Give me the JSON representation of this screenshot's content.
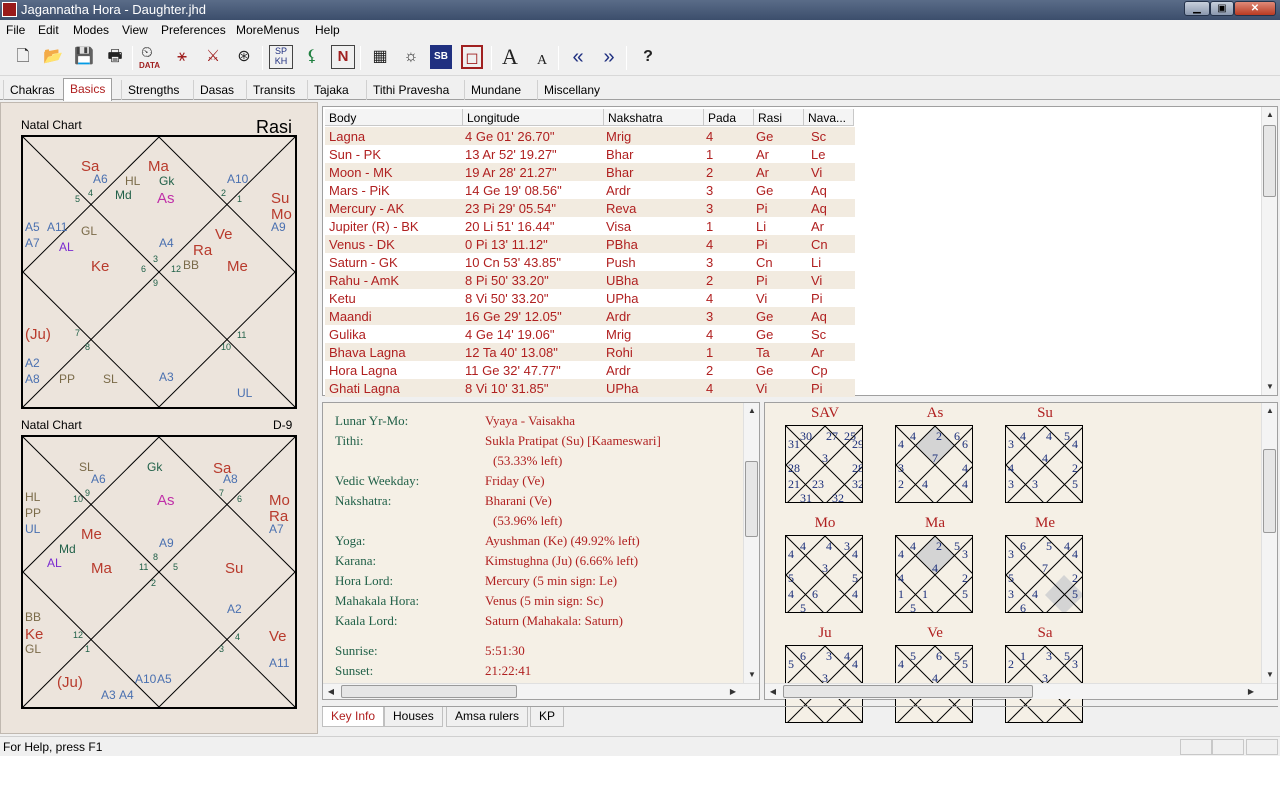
{
  "window": {
    "title": "Jagannatha Hora - Daughter.jhd"
  },
  "menu": [
    "File",
    "Edit",
    "Modes",
    "View",
    "Preferences",
    "MoreMenus",
    "Help"
  ],
  "toolbar": {
    "data_label": "DATA",
    "spkh_top": "SP",
    "spkh_bottom": "KH",
    "n_label": "N",
    "sb_label": "SB",
    "font_large": "A",
    "font_small": "A",
    "help_label": "?"
  },
  "tabs": [
    "Chakras",
    "Basics",
    "Strengths",
    "Dasas",
    "Transits",
    "Tajaka",
    "Tithi Pravesha",
    "Mundane",
    "Miscellany"
  ],
  "active_tab": "Basics",
  "chart1": {
    "label": "Natal Chart",
    "type": "Rasi",
    "items": [
      {
        "t": "Sa",
        "c": "#b83a2c"
      },
      {
        "t": "Ma",
        "c": "#b83a2c"
      },
      {
        "t": "A6",
        "c": "#4a70b0"
      },
      {
        "t": "HL",
        "c": "#7a6a48"
      },
      {
        "t": "Gk",
        "c": "#206048"
      },
      {
        "t": "Md",
        "c": "#206048"
      },
      {
        "t": "As",
        "c": "#c030a8"
      },
      {
        "t": "5",
        "c": "#206048"
      },
      {
        "t": "4",
        "c": "#206048"
      },
      {
        "t": "A10",
        "c": "#4a70b0"
      },
      {
        "t": "2",
        "c": "#206048"
      },
      {
        "t": "1",
        "c": "#206048"
      },
      {
        "t": "Su",
        "c": "#b83a2c"
      },
      {
        "t": "Mo",
        "c": "#b83a2c"
      },
      {
        "t": "A9",
        "c": "#4a70b0"
      },
      {
        "t": "A5",
        "c": "#4a70b0"
      },
      {
        "t": "A11",
        "c": "#4a70b0"
      },
      {
        "t": "A7",
        "c": "#4a70b0"
      },
      {
        "t": "GL",
        "c": "#7a6a48"
      },
      {
        "t": "AL",
        "c": "#7a2ad0"
      },
      {
        "t": "A4",
        "c": "#4a70b0"
      },
      {
        "t": "Ve",
        "c": "#b83a2c"
      },
      {
        "t": "3",
        "c": "#206048"
      },
      {
        "t": "Ra",
        "c": "#b83a2c"
      },
      {
        "t": "Ke",
        "c": "#b83a2c"
      },
      {
        "t": "6",
        "c": "#206048"
      },
      {
        "t": "12",
        "c": "#206048"
      },
      {
        "t": "BB",
        "c": "#7a6a48"
      },
      {
        "t": "Me",
        "c": "#b83a2c"
      },
      {
        "t": "9",
        "c": "#206048"
      },
      {
        "t": "(Ju)",
        "c": "#b83a2c"
      },
      {
        "t": "7",
        "c": "#206048"
      },
      {
        "t": "11",
        "c": "#206048"
      },
      {
        "t": "8",
        "c": "#206048"
      },
      {
        "t": "10",
        "c": "#206048"
      },
      {
        "t": "A2",
        "c": "#4a70b0"
      },
      {
        "t": "A8",
        "c": "#4a70b0"
      },
      {
        "t": "PP",
        "c": "#7a6a48"
      },
      {
        "t": "SL",
        "c": "#7a6a48"
      },
      {
        "t": "A3",
        "c": "#4a70b0"
      },
      {
        "t": "UL",
        "c": "#4a70b0"
      }
    ]
  },
  "chart2": {
    "label": "Natal Chart",
    "type": "D-9",
    "items": [
      {
        "t": "SL",
        "c": "#7a6a48"
      },
      {
        "t": "Gk",
        "c": "#206048"
      },
      {
        "t": "Sa",
        "c": "#b83a2c"
      },
      {
        "t": "A6",
        "c": "#4a70b0"
      },
      {
        "t": "A8",
        "c": "#4a70b0"
      },
      {
        "t": "9",
        "c": "#206048"
      },
      {
        "t": "10",
        "c": "#206048"
      },
      {
        "t": "As",
        "c": "#c030a8"
      },
      {
        "t": "7",
        "c": "#206048"
      },
      {
        "t": "6",
        "c": "#206048"
      },
      {
        "t": "HL",
        "c": "#7a6a48"
      },
      {
        "t": "PP",
        "c": "#7a6a48"
      },
      {
        "t": "UL",
        "c": "#4a70b0"
      },
      {
        "t": "Mo",
        "c": "#b83a2c"
      },
      {
        "t": "Ra",
        "c": "#b83a2c"
      },
      {
        "t": "A7",
        "c": "#4a70b0"
      },
      {
        "t": "Me",
        "c": "#b83a2c"
      },
      {
        "t": "Md",
        "c": "#206048"
      },
      {
        "t": "A9",
        "c": "#4a70b0"
      },
      {
        "t": "AL",
        "c": "#7a2ad0"
      },
      {
        "t": "Ma",
        "c": "#b83a2c"
      },
      {
        "t": "8",
        "c": "#206048"
      },
      {
        "t": "11",
        "c": "#206048"
      },
      {
        "t": "5",
        "c": "#206048"
      },
      {
        "t": "Su",
        "c": "#b83a2c"
      },
      {
        "t": "2",
        "c": "#206048"
      },
      {
        "t": "A2",
        "c": "#4a70b0"
      },
      {
        "t": "BB",
        "c": "#7a6a48"
      },
      {
        "t": "Ke",
        "c": "#b83a2c"
      },
      {
        "t": "GL",
        "c": "#7a6a48"
      },
      {
        "t": "12",
        "c": "#206048"
      },
      {
        "t": "1",
        "c": "#206048"
      },
      {
        "t": "4",
        "c": "#206048"
      },
      {
        "t": "Ve",
        "c": "#b83a2c"
      },
      {
        "t": "3",
        "c": "#206048"
      },
      {
        "t": "A11",
        "c": "#4a70b0"
      },
      {
        "t": "(Ju)",
        "c": "#b83a2c"
      },
      {
        "t": "A10",
        "c": "#4a70b0"
      },
      {
        "t": "A5",
        "c": "#4a70b0"
      },
      {
        "t": "A3",
        "c": "#4a70b0"
      },
      {
        "t": "A4",
        "c": "#4a70b0"
      }
    ]
  },
  "table": {
    "headers": [
      "Body",
      "Longitude",
      "Nakshatra",
      "Pada",
      "Rasi",
      "Nava..."
    ],
    "rows": [
      [
        "Lagna",
        "4 Ge 01' 26.70\"",
        "Mrig",
        "4",
        "Ge",
        "Sc"
      ],
      [
        "Sun - PK",
        "13 Ar 52' 19.27\"",
        "Bhar",
        "1",
        "Ar",
        "Le"
      ],
      [
        "Moon - MK",
        "19 Ar 28' 21.27\"",
        "Bhar",
        "2",
        "Ar",
        "Vi"
      ],
      [
        "Mars - PiK",
        "14 Ge 19' 08.56\"",
        "Ardr",
        "3",
        "Ge",
        "Aq"
      ],
      [
        "Mercury - AK",
        "23 Pi 29' 05.54\"",
        "Reva",
        "3",
        "Pi",
        "Aq"
      ],
      [
        "Jupiter (R) - BK",
        "20 Li 51' 16.44\"",
        "Visa",
        "1",
        "Li",
        "Ar"
      ],
      [
        "Venus - DK",
        "0 Pi 13' 11.12\"",
        "PBha",
        "4",
        "Pi",
        "Cn"
      ],
      [
        "Saturn - GK",
        "10 Cn 53' 43.85\"",
        "Push",
        "3",
        "Cn",
        "Li"
      ],
      [
        "Rahu - AmK",
        "8 Pi 50' 33.20\"",
        "UBha",
        "2",
        "Pi",
        "Vi"
      ],
      [
        "Ketu",
        "8 Vi 50' 33.20\"",
        "UPha",
        "4",
        "Vi",
        "Pi"
      ],
      [
        "Maandi",
        "16 Ge 29' 12.05\"",
        "Ardr",
        "3",
        "Ge",
        "Aq"
      ],
      [
        "Gulika",
        "4 Ge 14' 19.06\"",
        "Mrig",
        "4",
        "Ge",
        "Sc"
      ],
      [
        "Bhava Lagna",
        "12 Ta 40' 13.08\"",
        "Rohi",
        "1",
        "Ta",
        "Ar"
      ],
      [
        "Hora Lagna",
        "11 Ge 32' 47.77\"",
        "Ardr",
        "2",
        "Ge",
        "Cp"
      ],
      [
        "Ghati Lagna",
        "8 Vi 10' 31.85\"",
        "UPha",
        "4",
        "Vi",
        "Pi"
      ]
    ]
  },
  "keyinfo": [
    {
      "label": "Lunar Yr-Mo:",
      "value": "Vyaya - Vaisakha"
    },
    {
      "label": "Tithi:",
      "value": "Sukla Pratipat (Su) [Kaameswari]"
    },
    {
      "label": "",
      "value": "(53.33% left)"
    },
    {
      "label": "Vedic Weekday:",
      "value": "Friday (Ve)"
    },
    {
      "label": "Nakshatra:",
      "value": "Bharani (Ve)"
    },
    {
      "label": "",
      "value": "(53.96% left)"
    },
    {
      "label": "Yoga:",
      "value": "Ayushman (Ke) (49.92% left)"
    },
    {
      "label": "Karana:",
      "value": "Kimstughna (Ju) (6.66% left)"
    },
    {
      "label": "Hora Lord:",
      "value": "Mercury (5 min sign: Le)"
    },
    {
      "label": "Mahakala Hora:",
      "value": "Venus (5 min sign: Sc)"
    },
    {
      "label": "Kaala Lord:",
      "value": "Saturn (Mahakala: Saturn)"
    },
    {
      "label": "Sunrise:",
      "value": "5:51:30"
    },
    {
      "label": "Sunset:",
      "value": "21:22:41"
    }
  ],
  "vargas": [
    {
      "name": "SAV",
      "nums": [
        "30",
        "27",
        "25",
        "31",
        "29",
        "28",
        "3",
        "28",
        "21",
        "32",
        "23",
        "31",
        "32"
      ]
    },
    {
      "name": "As",
      "nums": [
        "4",
        "2",
        "6",
        "4",
        "6",
        "3",
        "7",
        "4",
        "2",
        "4",
        "4"
      ]
    },
    {
      "name": "Su",
      "nums": [
        "4",
        "4",
        "5",
        "3",
        "4",
        "4",
        "4",
        "2",
        "3",
        "5",
        "3"
      ]
    },
    {
      "name": "Mo",
      "nums": [
        "4",
        "4",
        "3",
        "4",
        "4",
        "5",
        "3",
        "5",
        "4",
        "4",
        "6",
        "5"
      ]
    },
    {
      "name": "Ma",
      "nums": [
        "4",
        "2",
        "5",
        "4",
        "3",
        "4",
        "4",
        "2",
        "1",
        "5",
        "1",
        "5"
      ]
    },
    {
      "name": "Me",
      "nums": [
        "6",
        "5",
        "4",
        "3",
        "4",
        "5",
        "7",
        "2",
        "3",
        "5",
        "4",
        "6"
      ]
    },
    {
      "name": "Ju",
      "nums": [
        "6",
        "3",
        "4",
        "5",
        "4",
        "3",
        "3"
      ]
    },
    {
      "name": "Ve",
      "nums": [
        "5",
        "6",
        "5",
        "4",
        "5",
        "3",
        "4"
      ]
    },
    {
      "name": "Sa",
      "nums": [
        "1",
        "3",
        "5",
        "2",
        "3",
        "4",
        "3"
      ]
    }
  ],
  "bottom_tabs": [
    "Key Info",
    "Houses",
    "Amsa rulers",
    "KP"
  ],
  "active_bottom_tab": "Key Info",
  "status": {
    "text": "For Help, press F1"
  },
  "colors": {
    "accent_red": "#b02020",
    "label_green": "#206048",
    "panel_bg": "#ece4dc"
  }
}
